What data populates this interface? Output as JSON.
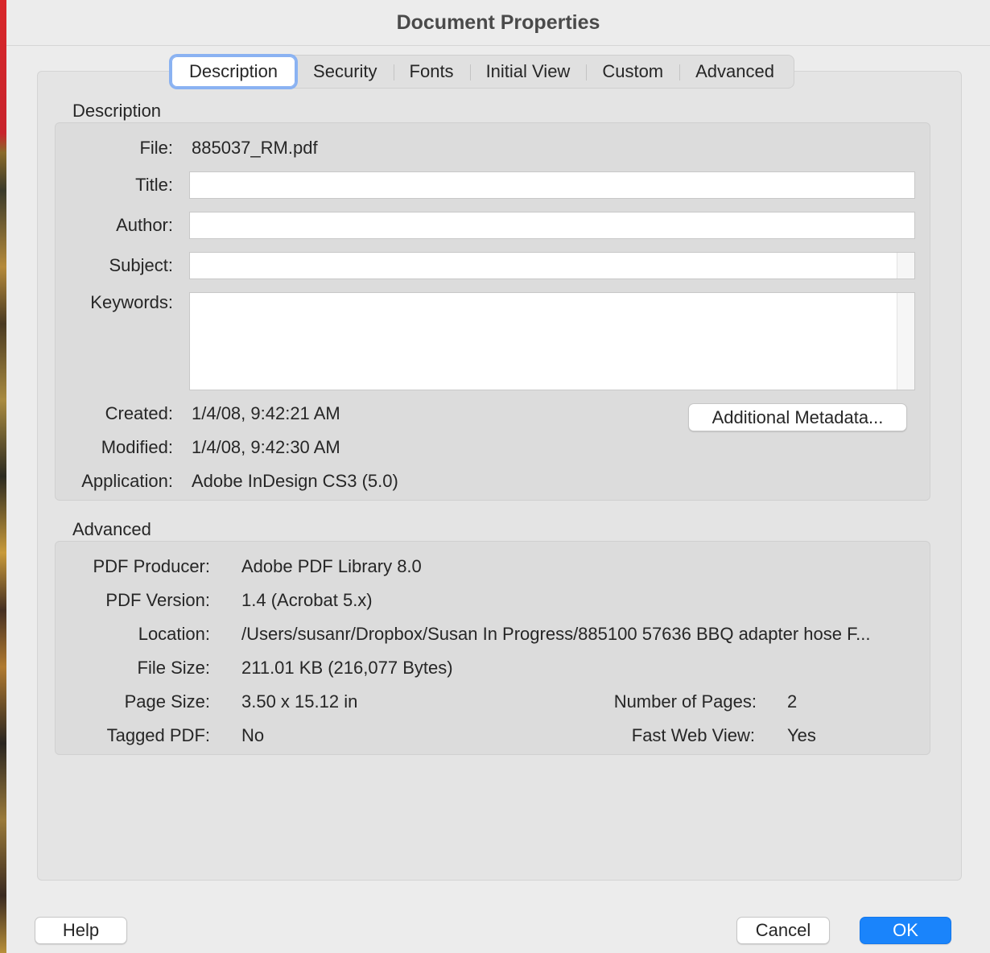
{
  "window": {
    "title": "Document Properties"
  },
  "tabs": [
    {
      "label": "Description",
      "active": true
    },
    {
      "label": "Security"
    },
    {
      "label": "Fonts"
    },
    {
      "label": "Initial View"
    },
    {
      "label": "Custom"
    },
    {
      "label": "Advanced"
    }
  ],
  "description": {
    "section_title": "Description",
    "file_label": "File:",
    "file_value": "885037_RM.pdf",
    "title_label": "Title:",
    "title_value": "",
    "author_label": "Author:",
    "author_value": "",
    "subject_label": "Subject:",
    "subject_value": "",
    "keywords_label": "Keywords:",
    "keywords_value": "",
    "created_label": "Created:",
    "created_value": "1/4/08, 9:42:21 AM",
    "modified_label": "Modified:",
    "modified_value": "1/4/08, 9:42:30 AM",
    "application_label": "Application:",
    "application_value": "Adobe InDesign CS3 (5.0)",
    "additional_metadata_button": "Additional Metadata..."
  },
  "advanced": {
    "section_title": "Advanced",
    "producer_label": "PDF Producer:",
    "producer_value": "Adobe PDF Library 8.0",
    "version_label": "PDF Version:",
    "version_value": "1.4 (Acrobat 5.x)",
    "location_label": "Location:",
    "location_value": "/Users/susanr/Dropbox/Susan In Progress/885100 57636 BBQ adapter hose F...",
    "filesize_label": "File Size:",
    "filesize_value": "211.01 KB (216,077 Bytes)",
    "pagesize_label": "Page Size:",
    "pagesize_value": "3.50 x 15.12 in",
    "numpages_label": "Number of Pages:",
    "numpages_value": "2",
    "tagged_label": "Tagged PDF:",
    "tagged_value": "No",
    "fastweb_label": "Fast Web View:",
    "fastweb_value": "Yes"
  },
  "footer": {
    "help_label": "Help",
    "cancel_label": "Cancel",
    "ok_label": "OK"
  },
  "colors": {
    "primary_button": "#1a84fb",
    "focus_ring": "#8ab2f2",
    "window_bg": "#ececec"
  }
}
